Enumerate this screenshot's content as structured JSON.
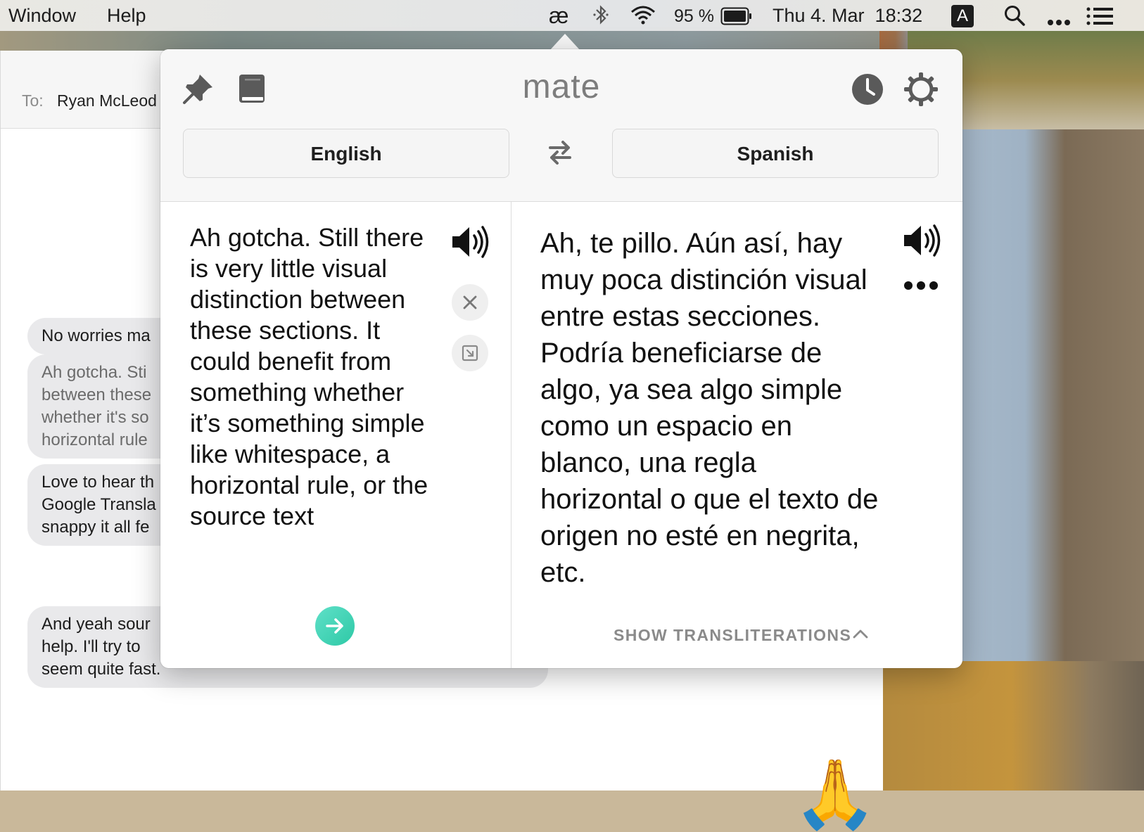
{
  "menubar": {
    "menus": [
      "Window",
      "Help"
    ],
    "status": {
      "app_icon": "æ",
      "battery": "95 %",
      "datetime": "Thu 4. Mar  18:32",
      "input_source": "A"
    }
  },
  "messages": {
    "to_label": "To:",
    "to_name": "Ryan McLeod",
    "bubbles": [
      "No worries ma",
      "Ah gotcha. Sti\nbetween these\nwhether it's so\nhorizontal rule",
      "Love to hear th\nGoogle Transla\nsnappy it all fe",
      "And yeah sour\nhelp. I'll try to\nseem quite fast."
    ],
    "emoji": "🙏"
  },
  "popover": {
    "title": "mate",
    "source_language": "English",
    "target_language": "Spanish",
    "source_text": "Ah gotcha. Still there is very little visual distinction between these sections. It could benefit from something whether it’s something simple like whitespace, a horizontal rule, or the source text",
    "translation": "Ah, te pillo. Aún así, hay muy poca distinción visual entre estas secciones. Podría beneficiarse de algo, ya sea algo simple como un espacio en blanco, una regla horizontal o que el texto de origen no esté en negrita, etc.",
    "show_transliterations": "SHOW TRANSLITERATIONS",
    "icons": {
      "pin": "pin-icon",
      "book": "book-icon",
      "history": "clock-icon",
      "settings": "gear-icon",
      "swap": "swap-icon",
      "speak": "speaker-icon",
      "clear": "close-icon",
      "more": "more-icon",
      "translate": "arrow-right-icon"
    },
    "colors": {
      "accent": "#2ec9a6"
    }
  }
}
